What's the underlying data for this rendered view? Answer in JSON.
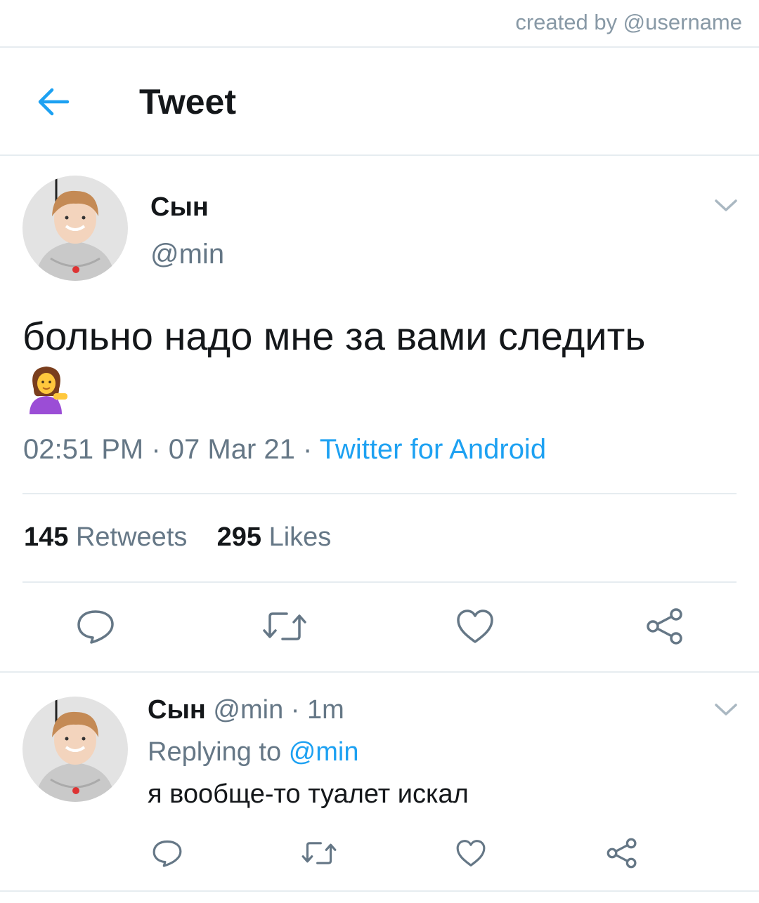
{
  "credit": "created by @username",
  "header": {
    "title": "Tweet"
  },
  "tweet": {
    "name": "Сын",
    "handle": "@min",
    "text": "больно надо мне за вами следить",
    "time": "02:51 PM",
    "date": "07 Mar 21",
    "source": "Twitter for Android",
    "retweets_count": "145",
    "retweets_label": "Retweets",
    "likes_count": "295",
    "likes_label": "Likes"
  },
  "reply": {
    "name": "Сын",
    "handle": "@min",
    "age": "1m",
    "replying_prefix": "Replying to",
    "replying_to": "@min",
    "text": "я вообще-то туалет искал"
  },
  "colors": {
    "accent": "#1da1f2",
    "muted": "#657786",
    "divider": "#e6ecf0",
    "text": "#14171a"
  },
  "icons": [
    "back-arrow-icon",
    "chevron-down-icon",
    "reply-icon",
    "retweet-icon",
    "like-icon",
    "share-icon",
    "woman-tipping-hand-emoji"
  ]
}
